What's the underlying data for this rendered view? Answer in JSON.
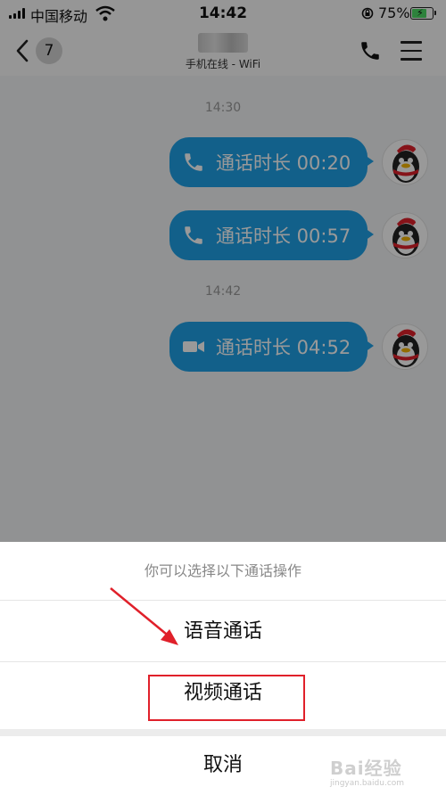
{
  "status": {
    "carrier": "中国移动",
    "time": "14:42",
    "battery": "75%",
    "battery_level": 0.75
  },
  "header": {
    "back_badge": "7",
    "subtitle": "手机在线 - WiFi"
  },
  "messages": [
    {
      "timestamp": "14:30"
    },
    {
      "type": "voice",
      "text": "通话时长 00:20"
    },
    {
      "type": "voice",
      "text": "通话时长 00:57"
    },
    {
      "timestamp": "14:42"
    },
    {
      "type": "video",
      "text": "通话时长 04:52"
    }
  ],
  "sheet": {
    "prompt": "你可以选择以下通话操作",
    "voice_call": "语音通话",
    "video_call": "视频通话",
    "cancel": "取消"
  },
  "watermark": {
    "text": "Bai经验",
    "sub": "jingyan.baidu.com"
  },
  "colors": {
    "bubble": "#1fa1e6",
    "highlight": "#e0202a",
    "battery": "#4cd964"
  },
  "icons": {
    "voice_call": "phone-icon",
    "video_call": "video-camera-icon",
    "header_call": "phone-icon",
    "menu": "menu-icon",
    "back": "chevron-left-icon"
  }
}
